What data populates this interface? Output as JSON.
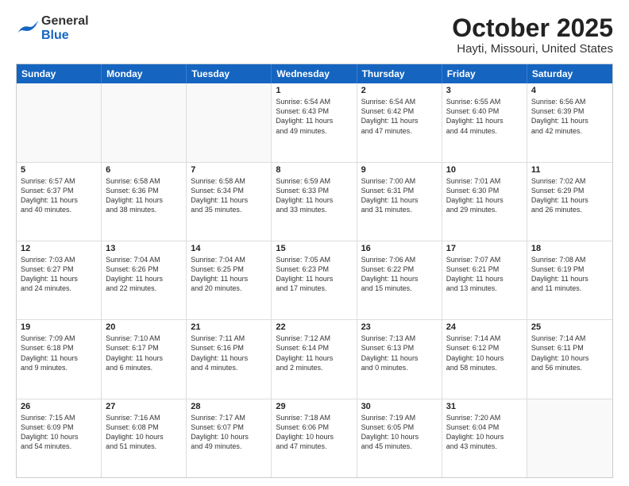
{
  "header": {
    "logo_general": "General",
    "logo_blue": "Blue",
    "title": "October 2025",
    "subtitle": "Hayti, Missouri, United States"
  },
  "days_of_week": [
    "Sunday",
    "Monday",
    "Tuesday",
    "Wednesday",
    "Thursday",
    "Friday",
    "Saturday"
  ],
  "weeks": [
    [
      {
        "day": "",
        "info": ""
      },
      {
        "day": "",
        "info": ""
      },
      {
        "day": "",
        "info": ""
      },
      {
        "day": "1",
        "info": "Sunrise: 6:54 AM\nSunset: 6:43 PM\nDaylight: 11 hours\nand 49 minutes."
      },
      {
        "day": "2",
        "info": "Sunrise: 6:54 AM\nSunset: 6:42 PM\nDaylight: 11 hours\nand 47 minutes."
      },
      {
        "day": "3",
        "info": "Sunrise: 6:55 AM\nSunset: 6:40 PM\nDaylight: 11 hours\nand 44 minutes."
      },
      {
        "day": "4",
        "info": "Sunrise: 6:56 AM\nSunset: 6:39 PM\nDaylight: 11 hours\nand 42 minutes."
      }
    ],
    [
      {
        "day": "5",
        "info": "Sunrise: 6:57 AM\nSunset: 6:37 PM\nDaylight: 11 hours\nand 40 minutes."
      },
      {
        "day": "6",
        "info": "Sunrise: 6:58 AM\nSunset: 6:36 PM\nDaylight: 11 hours\nand 38 minutes."
      },
      {
        "day": "7",
        "info": "Sunrise: 6:58 AM\nSunset: 6:34 PM\nDaylight: 11 hours\nand 35 minutes."
      },
      {
        "day": "8",
        "info": "Sunrise: 6:59 AM\nSunset: 6:33 PM\nDaylight: 11 hours\nand 33 minutes."
      },
      {
        "day": "9",
        "info": "Sunrise: 7:00 AM\nSunset: 6:31 PM\nDaylight: 11 hours\nand 31 minutes."
      },
      {
        "day": "10",
        "info": "Sunrise: 7:01 AM\nSunset: 6:30 PM\nDaylight: 11 hours\nand 29 minutes."
      },
      {
        "day": "11",
        "info": "Sunrise: 7:02 AM\nSunset: 6:29 PM\nDaylight: 11 hours\nand 26 minutes."
      }
    ],
    [
      {
        "day": "12",
        "info": "Sunrise: 7:03 AM\nSunset: 6:27 PM\nDaylight: 11 hours\nand 24 minutes."
      },
      {
        "day": "13",
        "info": "Sunrise: 7:04 AM\nSunset: 6:26 PM\nDaylight: 11 hours\nand 22 minutes."
      },
      {
        "day": "14",
        "info": "Sunrise: 7:04 AM\nSunset: 6:25 PM\nDaylight: 11 hours\nand 20 minutes."
      },
      {
        "day": "15",
        "info": "Sunrise: 7:05 AM\nSunset: 6:23 PM\nDaylight: 11 hours\nand 17 minutes."
      },
      {
        "day": "16",
        "info": "Sunrise: 7:06 AM\nSunset: 6:22 PM\nDaylight: 11 hours\nand 15 minutes."
      },
      {
        "day": "17",
        "info": "Sunrise: 7:07 AM\nSunset: 6:21 PM\nDaylight: 11 hours\nand 13 minutes."
      },
      {
        "day": "18",
        "info": "Sunrise: 7:08 AM\nSunset: 6:19 PM\nDaylight: 11 hours\nand 11 minutes."
      }
    ],
    [
      {
        "day": "19",
        "info": "Sunrise: 7:09 AM\nSunset: 6:18 PM\nDaylight: 11 hours\nand 9 minutes."
      },
      {
        "day": "20",
        "info": "Sunrise: 7:10 AM\nSunset: 6:17 PM\nDaylight: 11 hours\nand 6 minutes."
      },
      {
        "day": "21",
        "info": "Sunrise: 7:11 AM\nSunset: 6:16 PM\nDaylight: 11 hours\nand 4 minutes."
      },
      {
        "day": "22",
        "info": "Sunrise: 7:12 AM\nSunset: 6:14 PM\nDaylight: 11 hours\nand 2 minutes."
      },
      {
        "day": "23",
        "info": "Sunrise: 7:13 AM\nSunset: 6:13 PM\nDaylight: 11 hours\nand 0 minutes."
      },
      {
        "day": "24",
        "info": "Sunrise: 7:14 AM\nSunset: 6:12 PM\nDaylight: 10 hours\nand 58 minutes."
      },
      {
        "day": "25",
        "info": "Sunrise: 7:14 AM\nSunset: 6:11 PM\nDaylight: 10 hours\nand 56 minutes."
      }
    ],
    [
      {
        "day": "26",
        "info": "Sunrise: 7:15 AM\nSunset: 6:09 PM\nDaylight: 10 hours\nand 54 minutes."
      },
      {
        "day": "27",
        "info": "Sunrise: 7:16 AM\nSunset: 6:08 PM\nDaylight: 10 hours\nand 51 minutes."
      },
      {
        "day": "28",
        "info": "Sunrise: 7:17 AM\nSunset: 6:07 PM\nDaylight: 10 hours\nand 49 minutes."
      },
      {
        "day": "29",
        "info": "Sunrise: 7:18 AM\nSunset: 6:06 PM\nDaylight: 10 hours\nand 47 minutes."
      },
      {
        "day": "30",
        "info": "Sunrise: 7:19 AM\nSunset: 6:05 PM\nDaylight: 10 hours\nand 45 minutes."
      },
      {
        "day": "31",
        "info": "Sunrise: 7:20 AM\nSunset: 6:04 PM\nDaylight: 10 hours\nand 43 minutes."
      },
      {
        "day": "",
        "info": ""
      }
    ]
  ]
}
